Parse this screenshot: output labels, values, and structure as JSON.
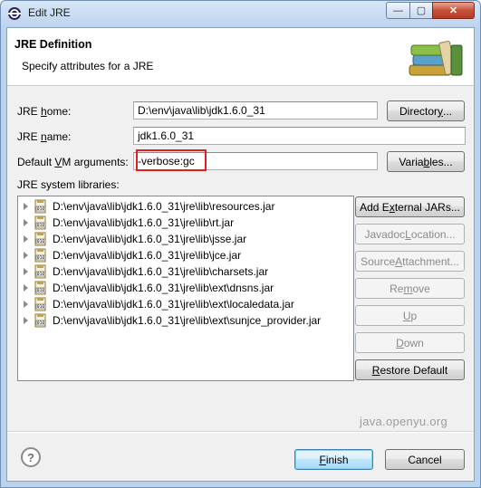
{
  "window": {
    "title": "Edit JRE",
    "close_glyph": "✕",
    "minimize_glyph": "—",
    "maximize_glyph": "▢"
  },
  "header": {
    "title": "JRE Definition",
    "subtitle": "Specify attributes for a JRE",
    "icon": "books-icon"
  },
  "form": {
    "jre_home_label_pre": "JRE ",
    "jre_home_label_u": "h",
    "jre_home_label_post": "ome:",
    "jre_home_value": "D:\\env\\java\\lib\\jdk1.6.0_31",
    "directory_pre": "Director",
    "directory_u": "y",
    "directory_post": "...",
    "jre_name_label_pre": "JRE ",
    "jre_name_label_u": "n",
    "jre_name_label_post": "ame:",
    "jre_name_value": "jdk1.6.0_31",
    "vm_args_label_pre": "Default ",
    "vm_args_label_u": "V",
    "vm_args_label_post": "M arguments:",
    "vm_args_value": "-verbose:gc",
    "variables_pre": "Varia",
    "variables_u": "b",
    "variables_post": "les...",
    "libraries_label": "JRE system libraries:"
  },
  "libraries": [
    "D:\\env\\java\\lib\\jdk1.6.0_31\\jre\\lib\\resources.jar",
    "D:\\env\\java\\lib\\jdk1.6.0_31\\jre\\lib\\rt.jar",
    "D:\\env\\java\\lib\\jdk1.6.0_31\\jre\\lib\\jsse.jar",
    "D:\\env\\java\\lib\\jdk1.6.0_31\\jre\\lib\\jce.jar",
    "D:\\env\\java\\lib\\jdk1.6.0_31\\jre\\lib\\charsets.jar",
    "D:\\env\\java\\lib\\jdk1.6.0_31\\jre\\lib\\ext\\dnsns.jar",
    "D:\\env\\java\\lib\\jdk1.6.0_31\\jre\\lib\\ext\\localedata.jar",
    "D:\\env\\java\\lib\\jdk1.6.0_31\\jre\\lib\\ext\\sunjce_provider.jar"
  ],
  "side_buttons": {
    "add_external_pre": "Add E",
    "add_external_u": "x",
    "add_external_post": "ternal JARs...",
    "javadoc_pre": "Javadoc ",
    "javadoc_u": "L",
    "javadoc_post": "ocation...",
    "source_pre": "Source ",
    "source_u": "A",
    "source_post": "ttachment...",
    "remove_pre": "Re",
    "remove_u": "m",
    "remove_post": "ove",
    "up_pre": "",
    "up_u": "U",
    "up_post": "p",
    "down_pre": "",
    "down_u": "D",
    "down_post": "own",
    "restore_pre": "",
    "restore_u": "R",
    "restore_post": "estore Default"
  },
  "watermark": "java.openyu.org",
  "footer": {
    "help_glyph": "?",
    "finish_pre": "",
    "finish_u": "F",
    "finish_post": "inish",
    "cancel": "Cancel"
  },
  "colors": {
    "highlight": "#e0201b",
    "title_bar": "#bcd3ee",
    "close_button": "#c7513a"
  }
}
